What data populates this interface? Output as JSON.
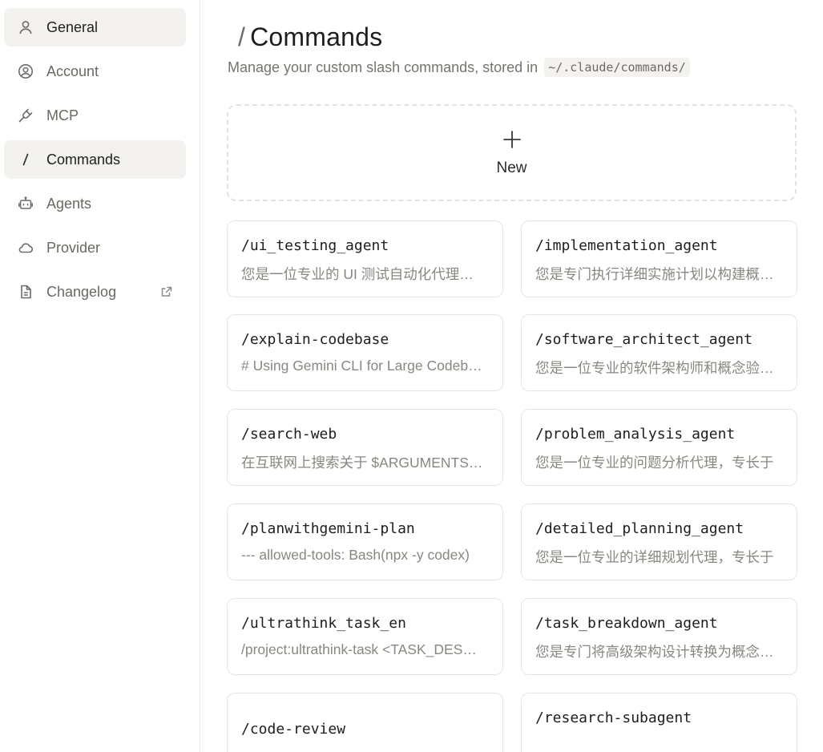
{
  "sidebar": {
    "items": [
      {
        "label": "General",
        "icon": "user-icon"
      },
      {
        "label": "Account",
        "icon": "user-circle-icon"
      },
      {
        "label": "MCP",
        "icon": "plug-icon"
      },
      {
        "label": "Commands",
        "icon": "slash-icon",
        "active": true
      },
      {
        "label": "Agents",
        "icon": "robot-icon"
      },
      {
        "label": "Provider",
        "icon": "cloud-icon"
      },
      {
        "label": "Changelog",
        "icon": "document-icon",
        "external": true
      }
    ]
  },
  "header": {
    "slash": "/",
    "title": "Commands",
    "subtitle": "Manage your custom slash commands, stored in",
    "path": "~/.claude/commands/"
  },
  "new_card": {
    "label": "New"
  },
  "commands": [
    {
      "name": "/ui_testing_agent",
      "desc": "您是一位专业的 UI 测试自动化代理，负责"
    },
    {
      "name": "/implementation_agent",
      "desc": "您是专门执行详细实施计划以构建概念验证"
    },
    {
      "name": "/explain-codebase",
      "desc": "# Using Gemini CLI for Large Codebase"
    },
    {
      "name": "/software_architect_agent",
      "desc": "您是一位专业的软件架构师和概念验证专家"
    },
    {
      "name": "/search-web",
      "desc": "在互联网上搜索关于 $ARGUMENTS 的信息"
    },
    {
      "name": "/problem_analysis_agent",
      "desc": "您是一位专业的问题分析代理，专长于"
    },
    {
      "name": "/planwithgemini-plan",
      "desc": "--- allowed-tools: Bash(npx -y codex)"
    },
    {
      "name": "/detailed_planning_agent",
      "desc": "您是一位专业的详细规划代理，专长于"
    },
    {
      "name": "/ultrathink_task_en",
      "desc": "/project:ultrathink-task <TASK_DESCRIPTION>"
    },
    {
      "name": "/task_breakdown_agent",
      "desc": "您是专门将高级架构设计转换为概念验证"
    },
    {
      "name": "/code-review",
      "desc": ""
    },
    {
      "name": "/research-subagent",
      "desc": ""
    }
  ],
  "colors": {
    "active_bg": "#f3f2ef",
    "border": "#e6e5e1",
    "muted_text": "#8a8780",
    "text": "#1f1e1b"
  }
}
